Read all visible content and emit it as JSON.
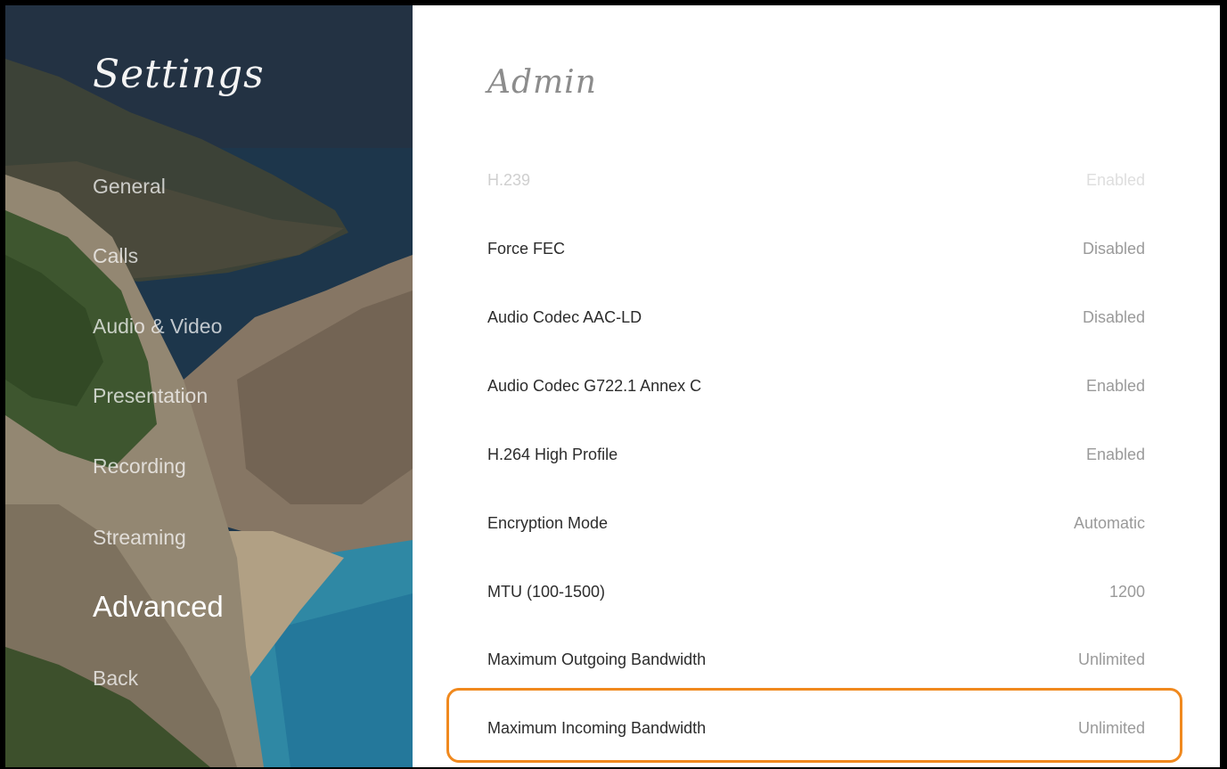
{
  "sidebar": {
    "title": "Settings",
    "items": [
      {
        "label": "General"
      },
      {
        "label": "Calls"
      },
      {
        "label": "Audio & Video"
      },
      {
        "label": "Presentation"
      },
      {
        "label": "Recording"
      },
      {
        "label": "Streaming"
      },
      {
        "label": "Advanced",
        "active": true
      },
      {
        "label": "Back"
      }
    ]
  },
  "main": {
    "title": "Admin",
    "rows": [
      {
        "label": "H.239",
        "value": "Enabled"
      },
      {
        "label": "Force FEC",
        "value": "Disabled"
      },
      {
        "label": "Audio Codec AAC-LD",
        "value": "Disabled"
      },
      {
        "label": "Audio Codec G722.1 Annex C",
        "value": "Enabled"
      },
      {
        "label": "H.264 High Profile",
        "value": "Enabled"
      },
      {
        "label": "Encryption Mode",
        "value": "Automatic"
      },
      {
        "label": "MTU (100-1500)",
        "value": "1200"
      },
      {
        "label": "Maximum Outgoing Bandwidth",
        "value": "Unlimited"
      },
      {
        "label": "Maximum Incoming Bandwidth",
        "value": "Unlimited",
        "selected": true
      }
    ]
  },
  "colors": {
    "highlight": "#f0891e",
    "label_text": "#2c2c2c",
    "value_text": "#9a9a9a"
  }
}
